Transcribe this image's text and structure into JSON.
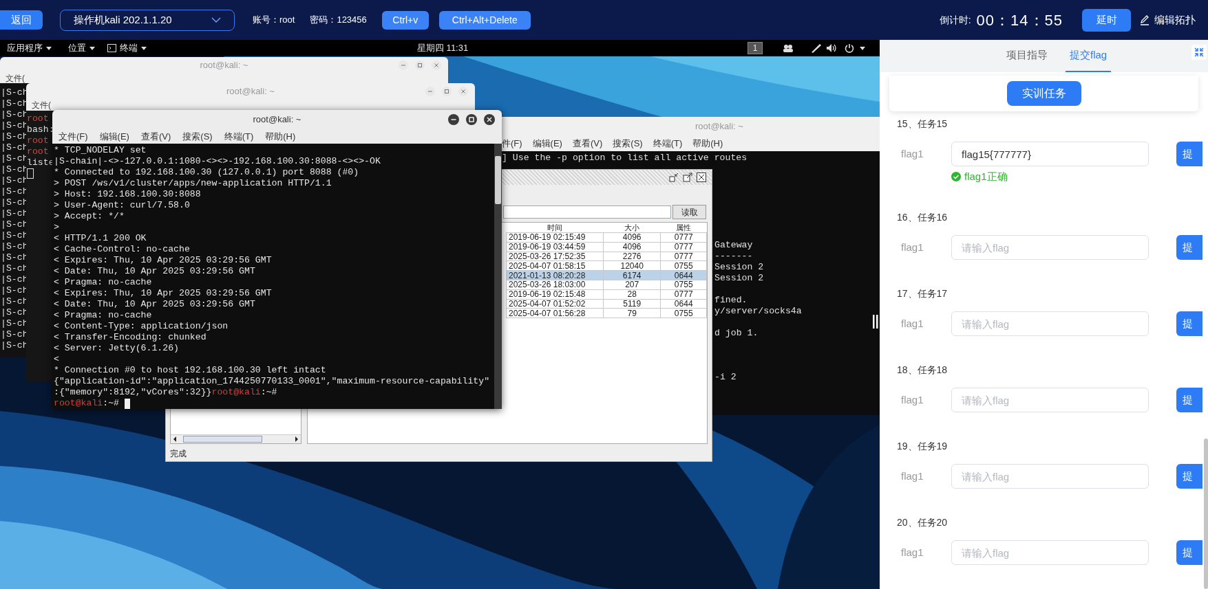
{
  "top_bar": {
    "back_button": "返回",
    "machine_select": "操作机kali 202.1.1.20",
    "account": "账号：root",
    "password": "密码：123456",
    "key_buttons": [
      "Ctrl+v",
      "Ctrl+Alt+Delete"
    ],
    "countdown_label": "倒计时:",
    "countdown": "00：14：55",
    "extend_button": "延时",
    "edit_topology": "编辑拓扑"
  },
  "desktop": {
    "panel": {
      "menus": [
        {
          "kind": "menu",
          "label": "应用程序"
        },
        {
          "kind": "menu",
          "label": "位置"
        },
        {
          "kind": "terminal",
          "label": "终端"
        }
      ],
      "clock": "星期四 11:31",
      "workspace": "1"
    },
    "back_terminal_1": {
      "title": "root@kali: ~",
      "menu": [
        "文件("
      ],
      "lines": [
        "|S-ch",
        "|S-ch",
        "|S-ch",
        "|S-ch",
        "|S-ch",
        "|S-ch",
        "|S-ch",
        "|S-ch",
        "|S-ch",
        "|S-ch",
        "|S-ch",
        "|S-ch",
        "|S-ch",
        "|S-ch",
        "|S-ch",
        "|S-ch",
        "|S-ch",
        "|S-ch",
        "|S-ch",
        "|S-ch",
        "|S-ch",
        "|S-ch",
        "|S-ch",
        "|S-ch"
      ]
    },
    "back_terminal_2": {
      "title": "root@kali: ~",
      "menu": [
        "文件("
      ],
      "lines": [
        {
          "kind": "prompt",
          "text": "root"
        },
        {
          "kind": "output",
          "text": "bash:"
        },
        {
          "kind": "prompt",
          "text": "root"
        },
        {
          "kind": "prompt",
          "text": "root"
        },
        {
          "kind": "output",
          "text": "liste"
        },
        {
          "kind": "cursor"
        }
      ]
    },
    "right_terminal": {
      "title": "root@kali: ~",
      "menu": [
        "件(F)",
        "编辑(E)",
        "查看(V)",
        "搜索(S)",
        "终端(T)",
        "帮助(H)"
      ],
      "top_line": "] Use the -p option to list all active routes",
      "side_blocks": [
        [
          "Gateway",
          "-------",
          "Session 2",
          "Session 2"
        ],
        [
          "fined.",
          "y/server/socks4a"
        ],
        [
          "d job 1."
        ],
        [
          "-i 2"
        ]
      ]
    },
    "file_manager": {
      "read_button": "读取",
      "columns": [
        "时间",
        "大小",
        "属性"
      ],
      "rows": [
        {
          "cells": [
            "2019-06-19 02:15:49",
            "4096",
            "0777"
          ],
          "selected": false
        },
        {
          "cells": [
            "2019-06-19 03:44:59",
            "4096",
            "0777"
          ],
          "selected": false
        },
        {
          "cells": [
            "2025-03-26 17:52:35",
            "2276",
            "0777"
          ],
          "selected": false
        },
        {
          "cells": [
            "2025-04-07 01:58:15",
            "12040",
            "0755"
          ],
          "selected": false
        },
        {
          "cells": [
            "2021-01-13 08:20:28",
            "6174",
            "0644"
          ],
          "selected": true
        },
        {
          "cells": [
            "2025-03-26 18:03:00",
            "207",
            "0755"
          ],
          "selected": false
        },
        {
          "cells": [
            "2019-06-19 02:15:48",
            "28",
            "0777"
          ],
          "selected": false
        },
        {
          "cells": [
            "2025-04-07 01:52:02",
            "5119",
            "0644"
          ],
          "selected": false
        },
        {
          "cells": [
            "2025-04-07 01:56:28",
            "79",
            "0755"
          ],
          "selected": false
        }
      ],
      "status": "完成"
    },
    "front_terminal": {
      "title": "root@kali: ~",
      "menu": [
        "文件(F)",
        "编辑(E)",
        "查看(V)",
        "搜索(S)",
        "终端(T)",
        "帮助(H)"
      ],
      "lines": [
        [
          {
            "kind": "output",
            "text": "* TCP_NODELAY set"
          }
        ],
        [
          {
            "kind": "output",
            "text": "|S-chain|-<>-127.0.0.1:1080-<><>-192.168.100.30:8088-<><>-OK"
          }
        ],
        [
          {
            "kind": "output",
            "text": "* Connected to 192.168.100.30 (127.0.0.1) port 8088 (#0)"
          }
        ],
        [
          {
            "kind": "output",
            "text": "> POST /ws/v1/cluster/apps/new-application HTTP/1.1"
          }
        ],
        [
          {
            "kind": "output",
            "text": "> Host: 192.168.100.30:8088"
          }
        ],
        [
          {
            "kind": "output",
            "text": "> User-Agent: curl/7.58.0"
          }
        ],
        [
          {
            "kind": "output",
            "text": "> Accept: */*"
          }
        ],
        [
          {
            "kind": "output",
            "text": ">"
          }
        ],
        [
          {
            "kind": "output",
            "text": "< HTTP/1.1 200 OK"
          }
        ],
        [
          {
            "kind": "output",
            "text": "< Cache-Control: no-cache"
          }
        ],
        [
          {
            "kind": "output",
            "text": "< Expires: Thu, 10 Apr 2025 03:29:56 GMT"
          }
        ],
        [
          {
            "kind": "output",
            "text": "< Date: Thu, 10 Apr 2025 03:29:56 GMT"
          }
        ],
        [
          {
            "kind": "output",
            "text": "< Pragma: no-cache"
          }
        ],
        [
          {
            "kind": "output",
            "text": "< Expires: Thu, 10 Apr 2025 03:29:56 GMT"
          }
        ],
        [
          {
            "kind": "output",
            "text": "< Date: Thu, 10 Apr 2025 03:29:56 GMT"
          }
        ],
        [
          {
            "kind": "output",
            "text": "< Pragma: no-cache"
          }
        ],
        [
          {
            "kind": "output",
            "text": "< Content-Type: application/json"
          }
        ],
        [
          {
            "kind": "output",
            "text": "< Transfer-Encoding: chunked"
          }
        ],
        [
          {
            "kind": "output",
            "text": "< Server: Jetty(6.1.26)"
          }
        ],
        [
          {
            "kind": "output",
            "text": "<"
          }
        ],
        [
          {
            "kind": "output",
            "text": "* Connection #0 to host 192.168.100.30 left intact"
          }
        ],
        [
          {
            "kind": "output",
            "text": "{\"application-id\":\"application_1744250770133_0001\",\"maximum-resource-capability\""
          }
        ],
        [
          {
            "kind": "output",
            "text": ":{\"memory\":8192,\"vCores\":32}}"
          },
          {
            "kind": "prompt",
            "text": "root@kali"
          },
          {
            "kind": "output",
            "text": ":~#"
          }
        ],
        [
          {
            "kind": "prompt",
            "text": "root@kali"
          },
          {
            "kind": "output",
            "text": ":~# "
          },
          {
            "kind": "cursor"
          }
        ]
      ]
    }
  },
  "side_panel": {
    "tabs": [
      {
        "label": "项目指导",
        "selected": false
      },
      {
        "label": "提交flag",
        "selected": true
      }
    ],
    "task_button": "实训任务",
    "tasks": [
      {
        "title": "15、任务15",
        "field_label": "flag1",
        "value": "flag15{777777}",
        "result": "flag1正确",
        "submit": "提"
      },
      {
        "title": "16、任务16",
        "field_label": "flag1",
        "placeholder": "请输入flag",
        "submit": "提"
      },
      {
        "title": "17、任务17",
        "field_label": "flag1",
        "placeholder": "请输入flag",
        "submit": "提"
      },
      {
        "title": "18、任务18",
        "field_label": "flag1",
        "placeholder": "请输入flag",
        "submit": "提"
      },
      {
        "title": "19、任务19",
        "field_label": "flag1",
        "placeholder": "请输入flag",
        "submit": "提"
      },
      {
        "title": "20、任务20",
        "field_label": "flag1",
        "placeholder": "请输入flag",
        "submit": "提"
      }
    ]
  }
}
